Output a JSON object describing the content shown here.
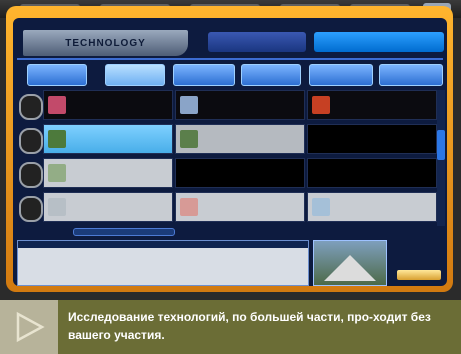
{
  "screen": {
    "title": "TECHNOLOGY",
    "tab_a": "",
    "tab_b": "",
    "categories": [
      "",
      "",
      "",
      "",
      "",
      ""
    ],
    "rows": [
      "",
      "",
      "",
      ""
    ],
    "slider_label": "",
    "detail_header_left": "",
    "detail_header_right": "",
    "detail_lines": [
      "",
      "",
      "",
      ""
    ],
    "action_button": ""
  },
  "caption": {
    "text": "Исследование технологий, по большей части, про-ходит без вашего  участия."
  },
  "colors": {
    "frame_orange": "#ffb52e",
    "screen_bg": "#0d1b3f",
    "highlight_blue": "#48aee9",
    "caption_bg": "#6b6d36"
  }
}
